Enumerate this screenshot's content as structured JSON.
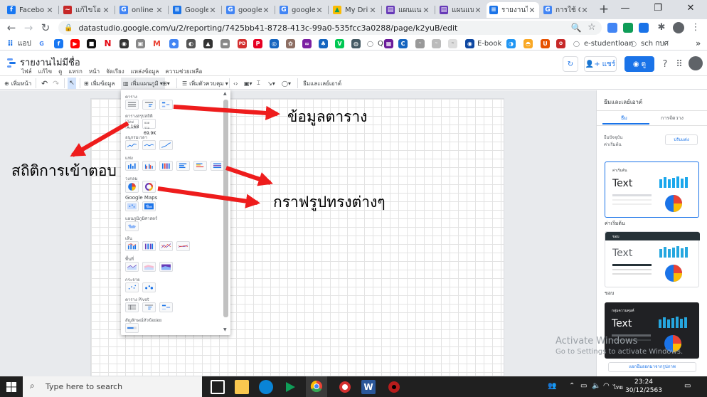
{
  "tabs": [
    {
      "title": "Facebo",
      "color": "#1877f2",
      "letter": "f"
    },
    {
      "title": "แก้ไขโอ",
      "color": "#c62828",
      "letter": "~"
    },
    {
      "title": "online",
      "color": "#4285f4",
      "letter": "G"
    },
    {
      "title": "Google",
      "color": "#1a73e8",
      "letter": "≡"
    },
    {
      "title": "google",
      "color": "#4285f4",
      "letter": "G"
    },
    {
      "title": "google",
      "color": "#4285f4",
      "letter": "G"
    },
    {
      "title": "My Driv",
      "color": "#fbbc04",
      "letter": "▲"
    },
    {
      "title": "แผนแนว",
      "color": "#673ab7",
      "letter": "▤"
    },
    {
      "title": "แผนแนว",
      "color": "#673ab7",
      "letter": "▤"
    },
    {
      "title": "รายงานไ",
      "color": "#1a73e8",
      "letter": "≡"
    },
    {
      "title": "การใช้ G",
      "color": "#4285f4",
      "letter": "G"
    }
  ],
  "address": {
    "url": "datastudio.google.com/u/2/reporting/7425bb41-8728-413c-99a0-535fcc3a0288/page/k2yuB/edit"
  },
  "bookmarks": {
    "apps": "แอป",
    "qr": "QR",
    "ebook": "E-book",
    "estudent": "e-studentloan",
    "sch": "sch กบศ"
  },
  "header": {
    "title": "รายงานไม่มีชื่อ",
    "menu": [
      "ไฟล์",
      "แก้ไข",
      "ดู",
      "แทรก",
      "หน้า",
      "จัดเรียง",
      "แหล่งข้อมูล",
      "ความช่วยเหลือ"
    ],
    "share": "แชร์",
    "view": "ดู"
  },
  "toolbar": {
    "add_page": "เพิ่มหน้า",
    "add_data": "เพิ่มข้อมูล",
    "add_chart": "เพิ่มแผนภูมิ",
    "add_control": "เพิ่มตัวควบคุม",
    "theme": "ธีมและเลย์เอาต์"
  },
  "chart_panel": {
    "sections": {
      "table": "ตาราง",
      "scorecard": "ตารางสรุปสถิติ",
      "timeseries": "อนุกรมเวลา",
      "bar": "แท่ง",
      "pie": "วงกลม",
      "geo": "Google Maps",
      "geomap": "แผนภูมิภูมิศาสตร์",
      "line": "เส้น",
      "area": "พื้นที่",
      "scatter": "กระจาย",
      "pivot": "ตาราง Pivot",
      "bullet": "สัญลักษณ์หัวข้อย่อย"
    },
    "scorecard_values": {
      "a_label": "Total",
      "a_value": "1,168",
      "b_label": "ยอดรวม",
      "b_value": "69.9K"
    }
  },
  "theme_panel": {
    "title": "ธีมและเลย์เอาต์",
    "tab_theme": "ธีม",
    "tab_layout": "การจัดวาง",
    "current_label": "ธีมปัจจุบัน",
    "current_value": "ค่าเริ่มต้น",
    "customize": "ปรับแต่ง",
    "cards": [
      {
        "small": "ค่าเริ่มต้น",
        "text": "Text",
        "label": "ค่าเริ่มต้น"
      },
      {
        "small": "ขอบ",
        "text": "Text",
        "label": "ขอบ"
      },
      {
        "small": "กลุ่มความคุมค์",
        "text": "Text",
        "label": ""
      }
    ],
    "extract": "แยกธีมออกมาจากรูปภาพ"
  },
  "annotations": {
    "table_data": "ข้อมูลตาราง",
    "stats": "สถิติการเข้าตอบ",
    "charts": "กราฟรูปทรงต่างๆ"
  },
  "watermark": {
    "line1": "Activate Windows",
    "line2": "Go to Settings to activate Windows."
  },
  "taskbar": {
    "search_placeholder": "Type here to search",
    "time": "23:24",
    "date": "30/12/2563",
    "lang": "ไทย"
  },
  "colors": {
    "accent": "#1a73e8",
    "arrow": "#ee1c1c",
    "chart_blue": "#1aa7ec",
    "chart_teal": "#26a7df"
  }
}
